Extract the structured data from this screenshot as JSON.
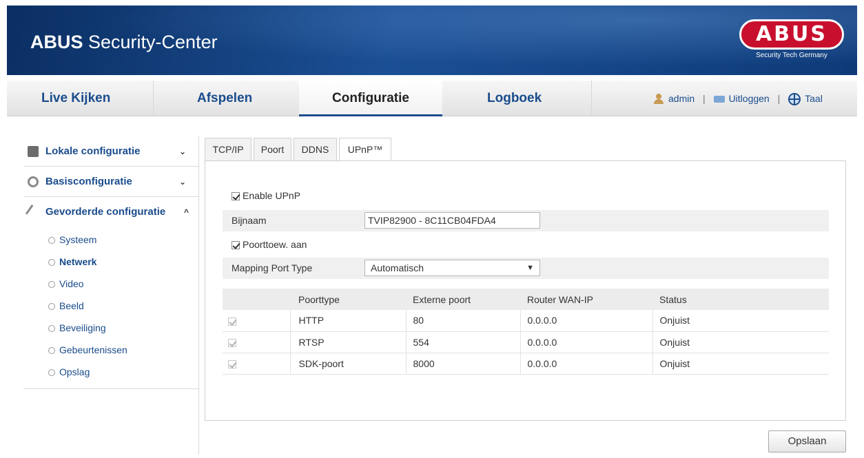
{
  "header": {
    "title_bold": "ABUS",
    "title_rest": " Security-Center",
    "logo_text": "ABUS",
    "logo_tagline": "Security Tech Germany"
  },
  "nav": {
    "tabs": [
      "Live Kijken",
      "Afspelen",
      "Configuratie",
      "Logboek"
    ],
    "active_tab": "Configuratie",
    "user": "admin",
    "logout": "Uitloggen",
    "language": "Taal",
    "separator": "|"
  },
  "sidebar": {
    "groups": [
      {
        "label": "Lokale configuratie",
        "chevron": "⌄",
        "icon": "monitor-icon"
      },
      {
        "label": "Basisconfiguratie",
        "chevron": "⌄",
        "icon": "gear-icon"
      },
      {
        "label": "Gevorderde configuratie",
        "chevron": "^",
        "icon": "wrench-icon"
      }
    ],
    "items": [
      "Systeem",
      "Netwerk",
      "Video",
      "Beeld",
      "Beveiliging",
      "Gebeurtenissen",
      "Opslag"
    ],
    "active_item": "Netwerk"
  },
  "tabs": [
    "TCP/IP",
    "Poort",
    "DDNS",
    "UPnP™"
  ],
  "active_tab": "UPnP™",
  "form": {
    "enable_upnp_label": "Enable UPnP",
    "enable_upnp_checked": true,
    "alias_label": "Bijnaam",
    "alias_value": "TVIP82900 - 8C11CB04FDA4",
    "port_mapping_label": "Poorttoew. aan",
    "port_mapping_checked": true,
    "mapping_type_label": "Mapping Port Type",
    "mapping_type_value": "Automatisch",
    "select_arrow": "▼"
  },
  "port_table": {
    "columns": [
      "",
      "Poorttype",
      "Externe poort",
      "Router WAN-IP",
      "Status"
    ],
    "rows": [
      {
        "type": "HTTP",
        "port": "80",
        "wan_ip": "0.0.0.0",
        "status": "Onjuist"
      },
      {
        "type": "RTSP",
        "port": "554",
        "wan_ip": "0.0.0.0",
        "status": "Onjuist"
      },
      {
        "type": "SDK-poort",
        "port": "8000",
        "wan_ip": "0.0.0.0",
        "status": "Onjuist"
      }
    ]
  },
  "save_label": "Opslaan",
  "colors": {
    "brand_blue": "#1a4c8c",
    "header_dark": "#0b2f63",
    "logo_red": "#c8102e"
  }
}
